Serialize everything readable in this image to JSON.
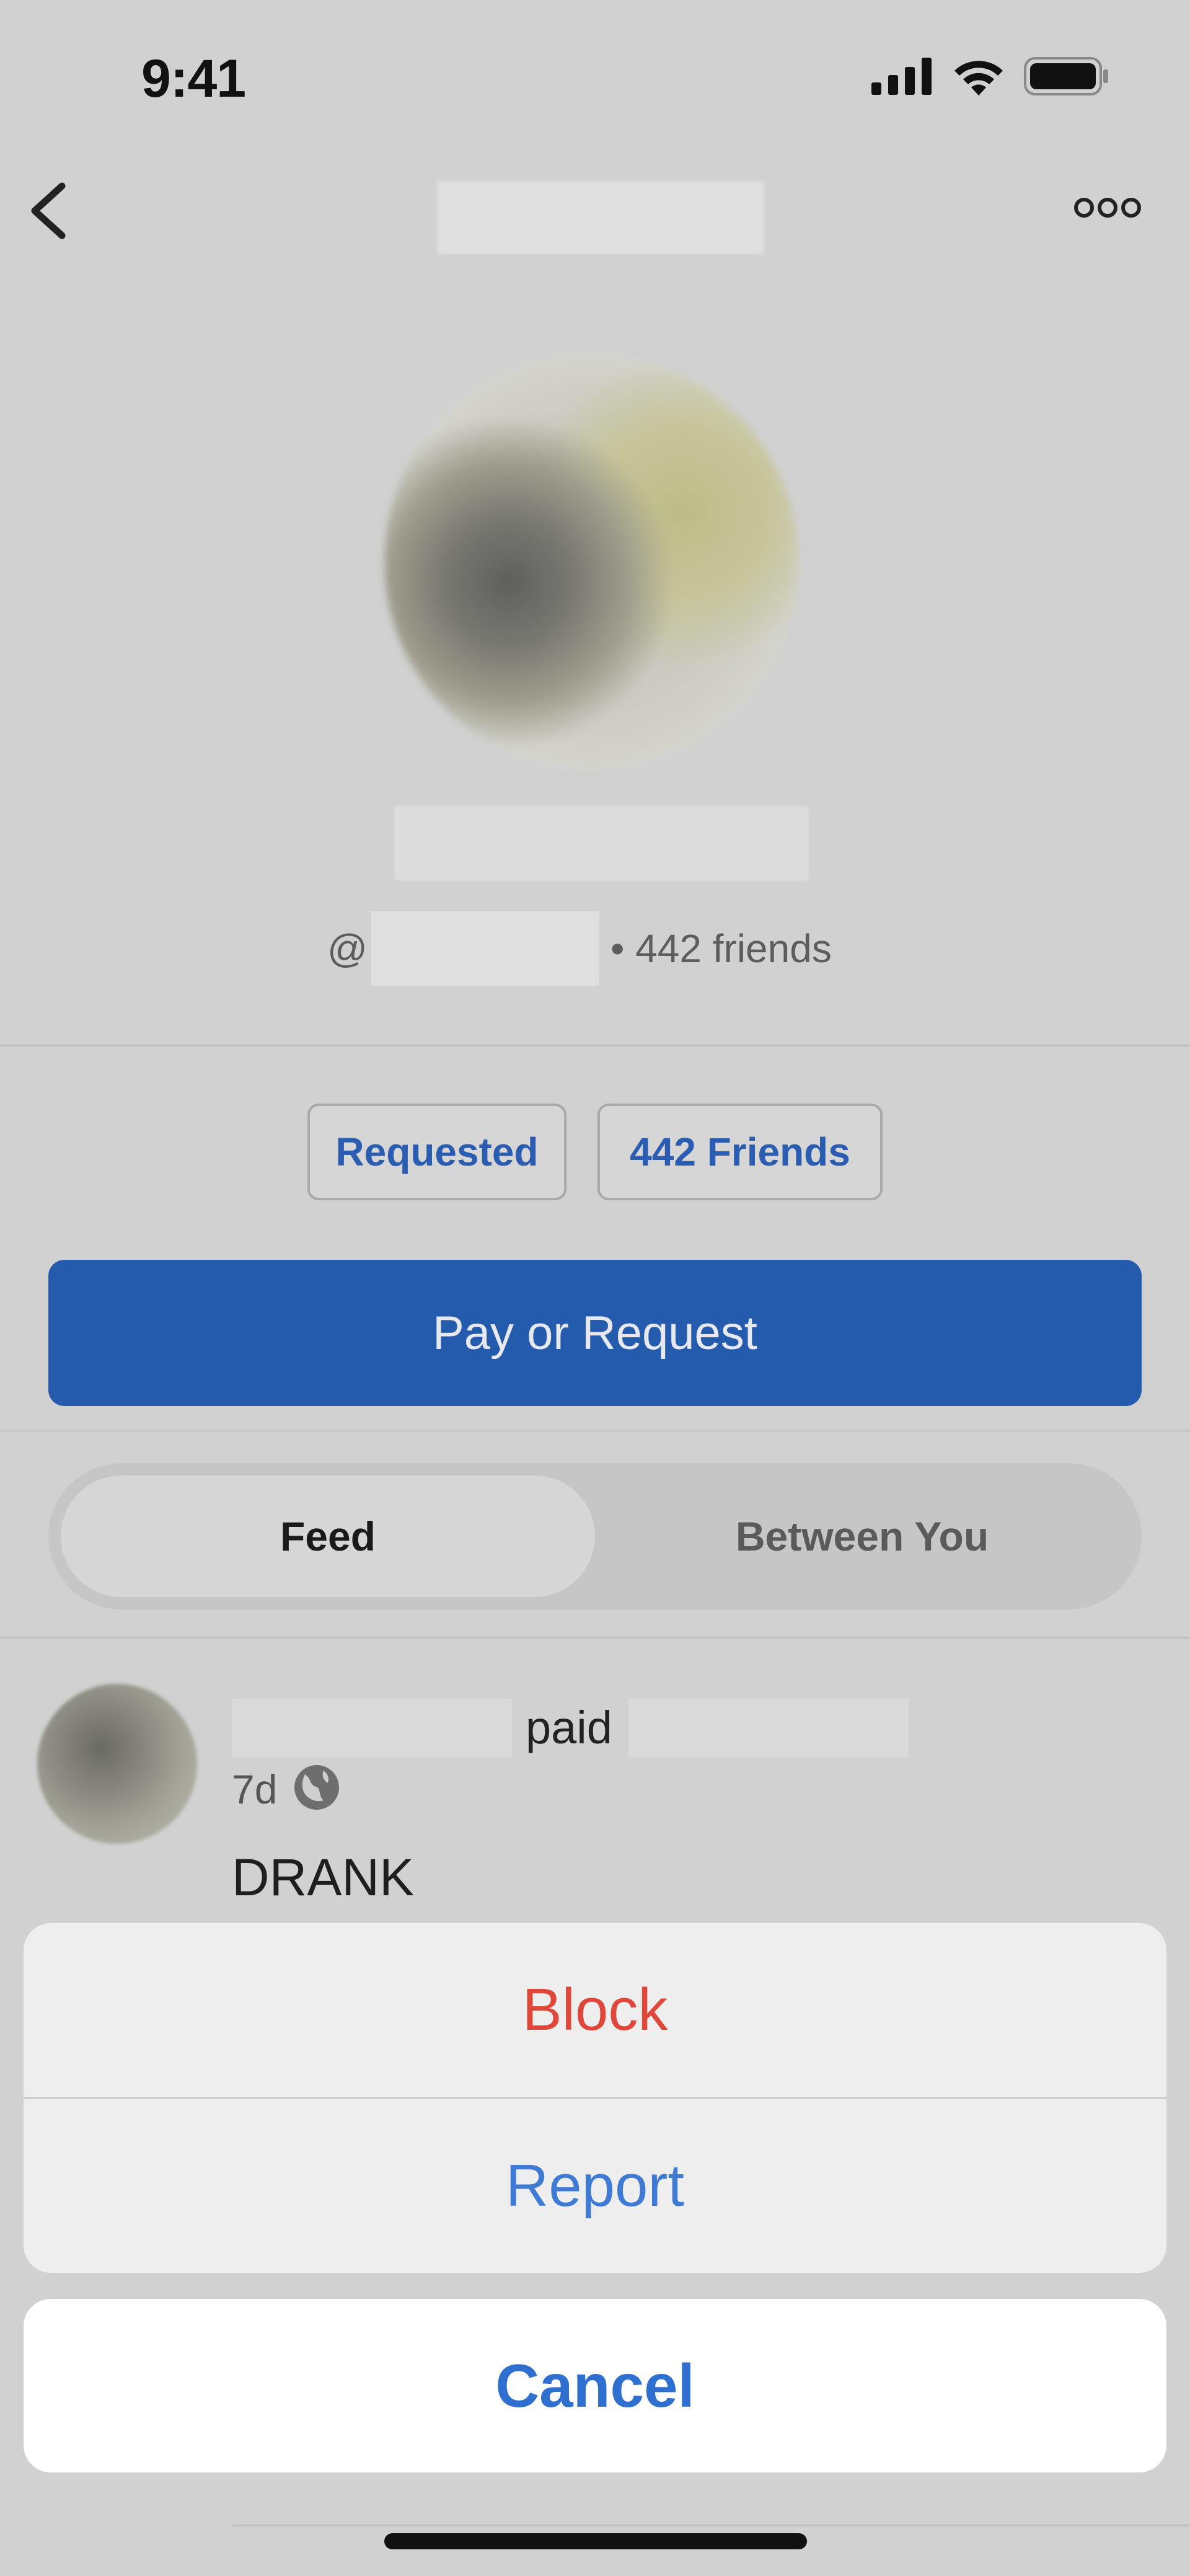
{
  "status_bar": {
    "time": "9:41"
  },
  "profile": {
    "username_prefix": "@",
    "friends_summary": "• 442 friends"
  },
  "actions": {
    "requested_label": "Requested",
    "friends_label": "442 Friends",
    "pay_label": "Pay or Request"
  },
  "tabs": {
    "feed_label": "Feed",
    "between_label": "Between You",
    "selected": "Feed"
  },
  "feed": {
    "items": [
      {
        "verb": "paid",
        "time": "7d",
        "note": "DRANK"
      }
    ]
  },
  "action_sheet": {
    "block_label": "Block",
    "report_label": "Report",
    "cancel_label": "Cancel"
  },
  "colors": {
    "accent": "#255bad",
    "destructive": "#e0473b",
    "link": "#2a5db2"
  }
}
